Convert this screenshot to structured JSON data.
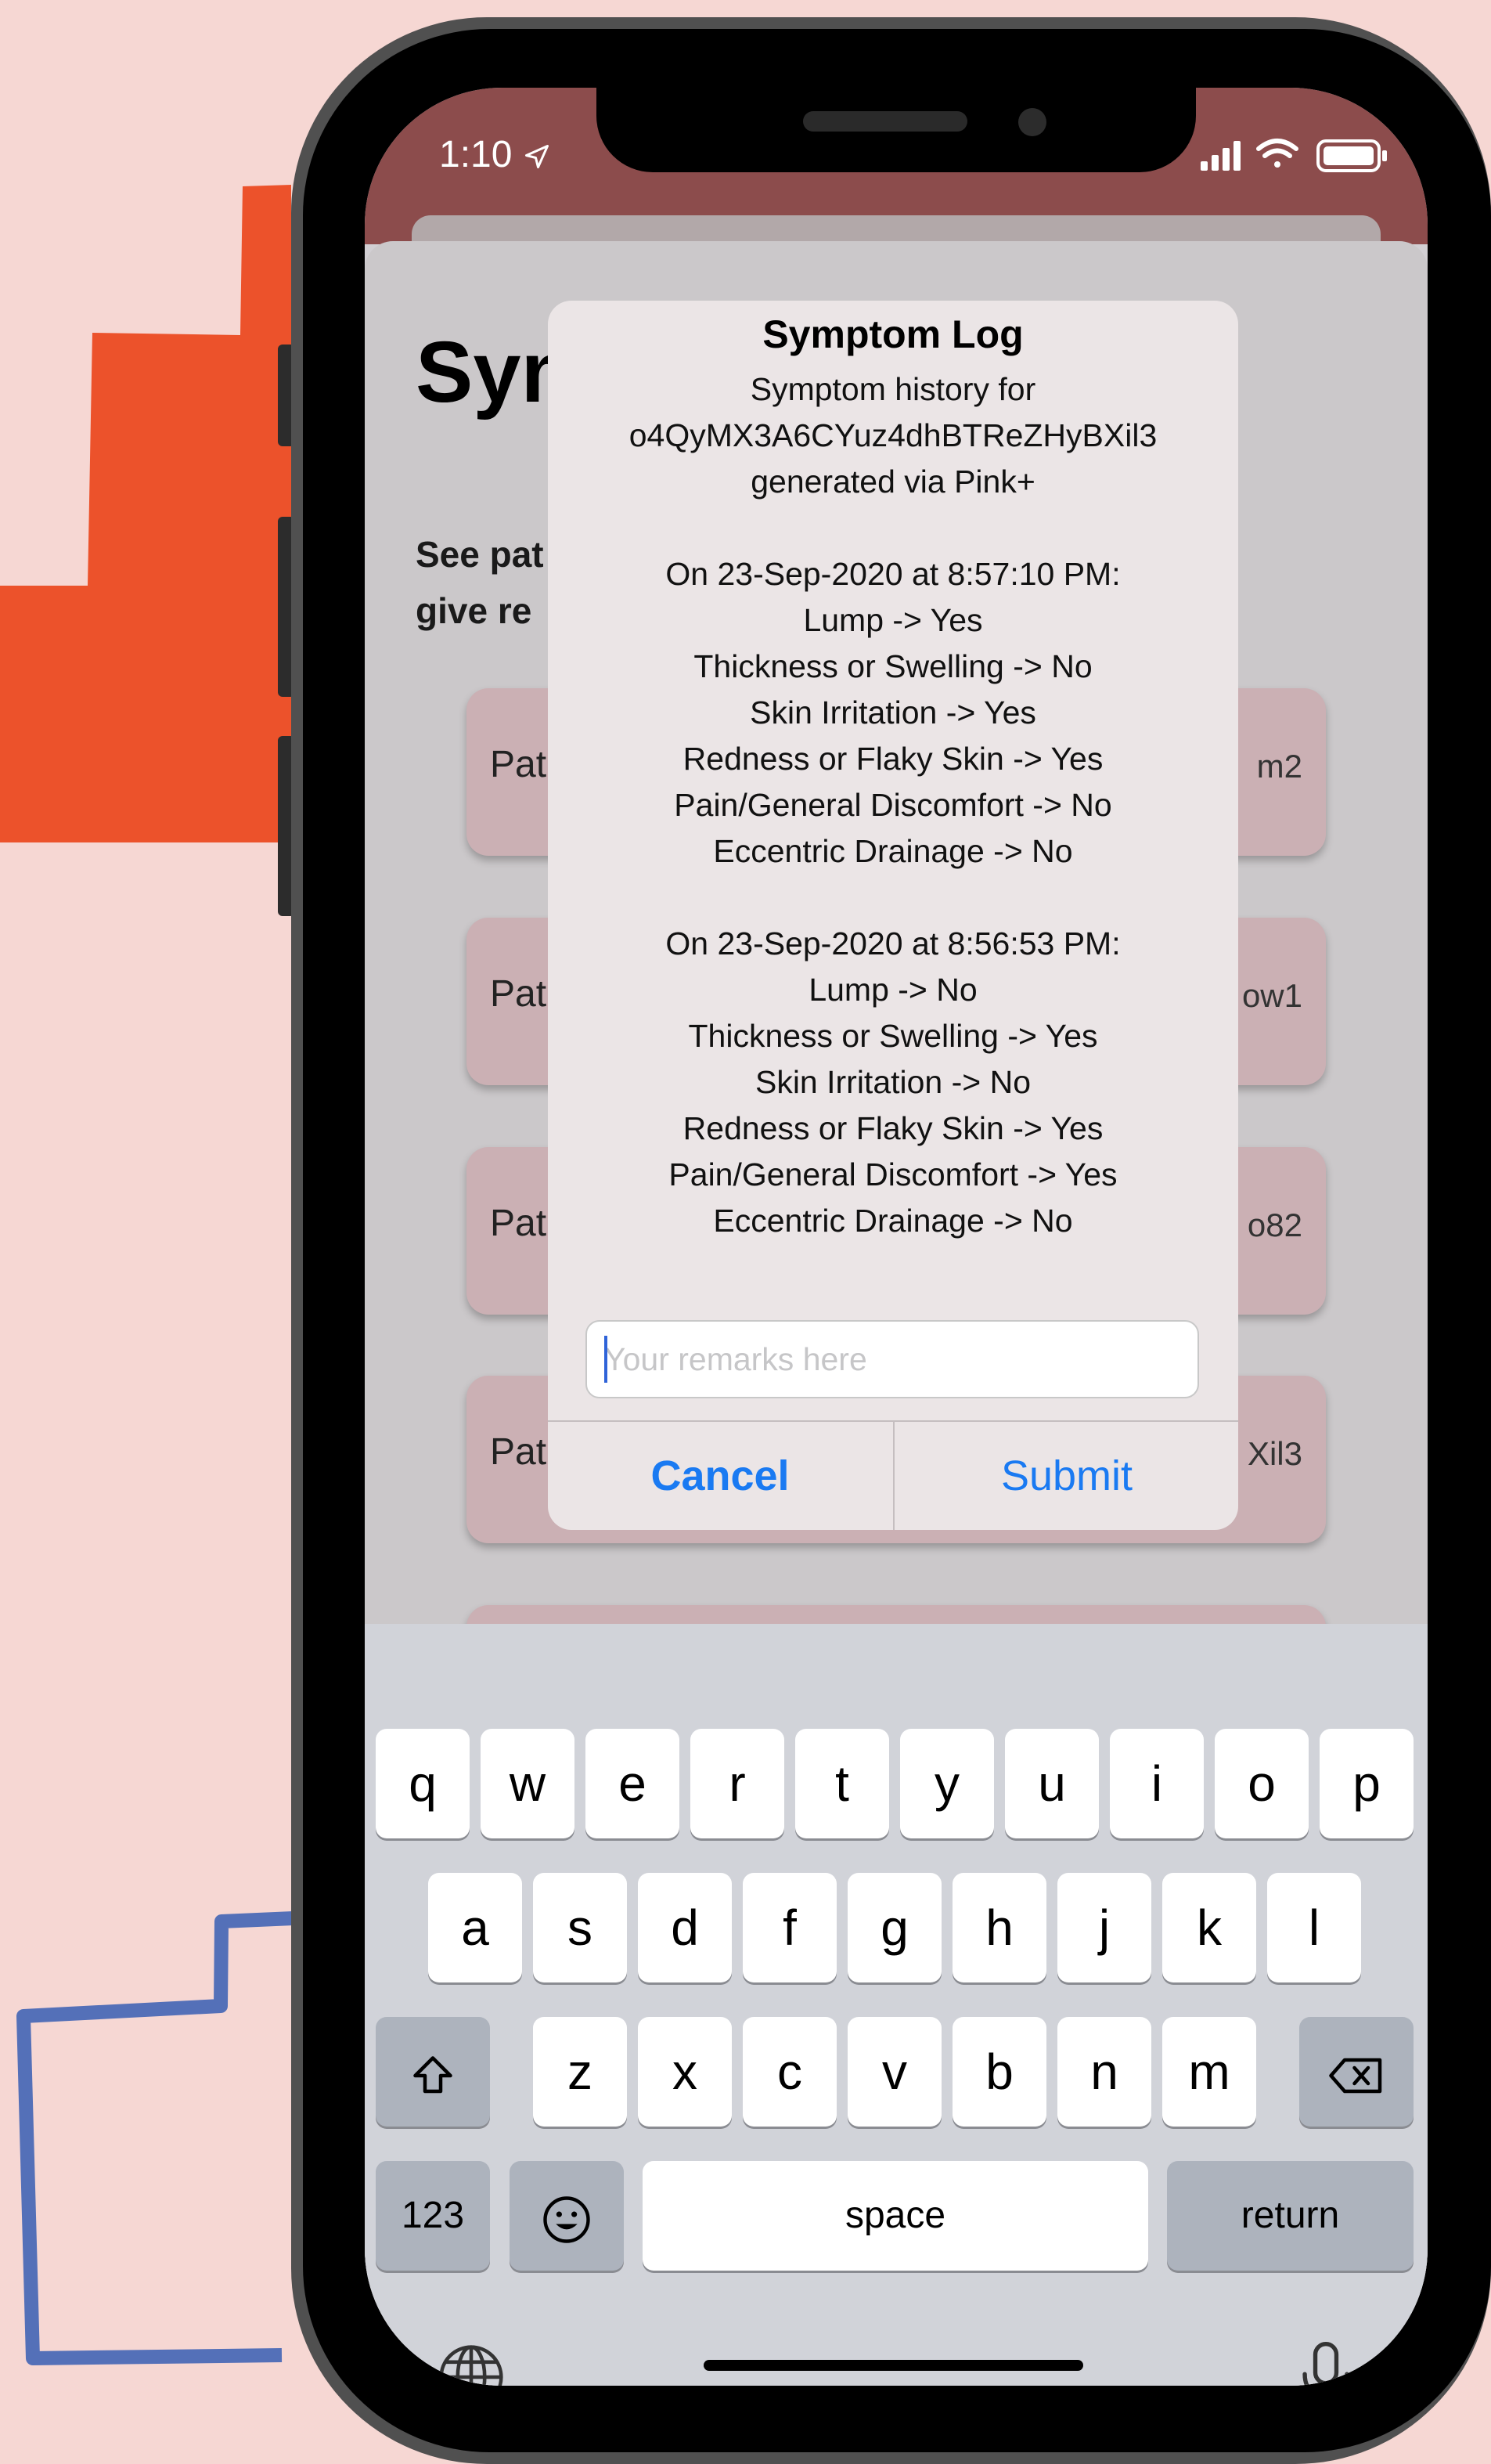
{
  "status_bar": {
    "time": "1:10"
  },
  "background_screen": {
    "title": "Sym",
    "description": "See pat                                                        d\ngive re",
    "cards": [
      {
        "label": "Pat",
        "id_fragment": "m2"
      },
      {
        "label": "Pat",
        "id_fragment": "ow1"
      },
      {
        "label": "Pat",
        "id_fragment": "o82"
      },
      {
        "label": "Pat",
        "id_fragment": "Xil3"
      }
    ]
  },
  "dialog": {
    "title": "Symptom Log",
    "body": "Symptom history for\no4QyMX3A6CYuz4dhBTReZHyBXil3\ngenerated via Pink+\n\nOn 23-Sep-2020 at 8:57:10 PM:\nLump -> Yes\nThickness or Swelling -> No\nSkin Irritation -> Yes\nRedness or Flaky Skin -> Yes\nPain/General Discomfort -> No\nEccentric Drainage -> No\n\nOn 23-Sep-2020 at 8:56:53 PM:\nLump -> No\nThickness or Swelling -> Yes\nSkin Irritation -> No\nRedness or Flaky Skin -> Yes\nPain/General Discomfort -> Yes\nEccentric Drainage -> No",
    "remarks_placeholder": "Your remarks here",
    "cancel_label": "Cancel",
    "submit_label": "Submit"
  },
  "keyboard": {
    "row1": [
      "q",
      "w",
      "e",
      "r",
      "t",
      "y",
      "u",
      "i",
      "o",
      "p"
    ],
    "row2": [
      "a",
      "s",
      "d",
      "f",
      "g",
      "h",
      "j",
      "k",
      "l"
    ],
    "row3": [
      "z",
      "x",
      "c",
      "v",
      "b",
      "n",
      "m"
    ],
    "numbers_label": "123",
    "space_label": "space",
    "return_label": "return"
  },
  "colors": {
    "page_background": "#f6d7d3",
    "accent_orange": "#ec522b",
    "accent_blue": "#5470b8",
    "status_bar": "#8c4c4c",
    "card": "#cbb0b4",
    "button_text": "#1a7af2"
  },
  "icons": [
    "signal-icon",
    "wifi-icon",
    "battery-icon",
    "location-arrow-icon",
    "shift-icon",
    "backspace-icon",
    "emoji-icon",
    "globe-icon",
    "microphone-icon"
  ]
}
